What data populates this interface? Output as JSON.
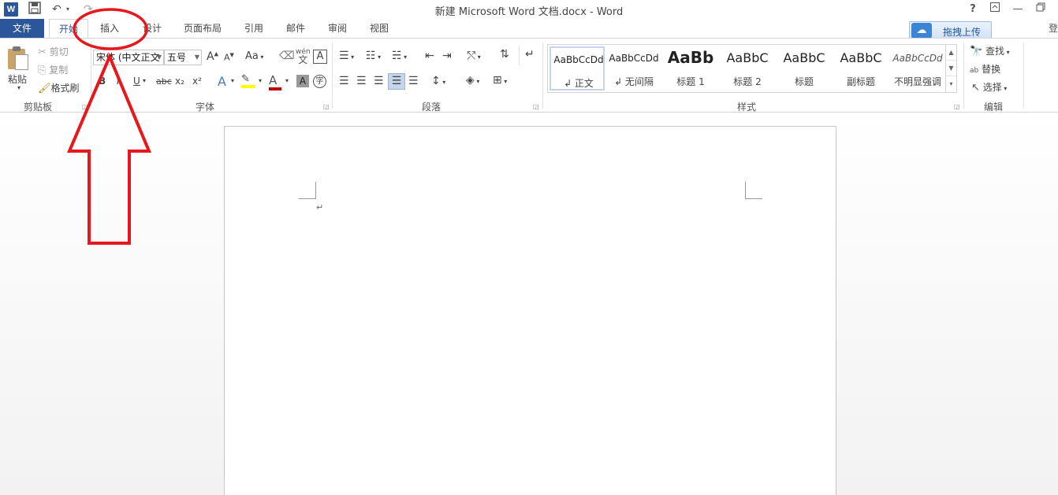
{
  "window": {
    "title": "新建 Microsoft Word 文档.docx - Word",
    "app_icon": "W",
    "help_label": "?",
    "right_edge_glyph": "登"
  },
  "quick_access": {
    "save_icon": "save-icon",
    "undo_icon": "undo-icon",
    "redo_icon": "redo-icon"
  },
  "tabs": [
    {
      "label": "文件"
    },
    {
      "label": "开始"
    },
    {
      "label": "插入"
    },
    {
      "label": "设计"
    },
    {
      "label": "页面布局"
    },
    {
      "label": "引用"
    },
    {
      "label": "邮件"
    },
    {
      "label": "审阅"
    },
    {
      "label": "视图"
    }
  ],
  "upload_button": {
    "label": "拖拽上传"
  },
  "clipboard": {
    "paste": "粘贴",
    "cut": "剪切",
    "copy": "复制",
    "format_painter": "格式刷",
    "group_label": "剪贴板"
  },
  "font": {
    "font_name": "宋体 (中文正文",
    "font_size": "五号",
    "group_label": "字体",
    "bold": "B",
    "italic": "I",
    "underline": "U",
    "strike": "abc",
    "sub": "x₂",
    "sup": "x²",
    "grow": "A",
    "shrink": "A",
    "case": "Aa",
    "pinyin": "wén",
    "border_char": "A",
    "shade_char": "A",
    "enclose": "字"
  },
  "paragraph": {
    "group_label": "段落"
  },
  "styles": {
    "group_label": "样式",
    "items": [
      {
        "sample": "AaBbCcDd",
        "name": "↲ 正文"
      },
      {
        "sample": "AaBbCcDd",
        "name": "↲ 无间隔"
      },
      {
        "sample": "AaBb",
        "name": "标题 1"
      },
      {
        "sample": "AaBbC",
        "name": "标题 2"
      },
      {
        "sample": "AaBbC",
        "name": "标题"
      },
      {
        "sample": "AaBbC",
        "name": "副标题"
      },
      {
        "sample": "AaBbCcDd",
        "name": "不明显强调"
      }
    ]
  },
  "editing": {
    "find": "查找",
    "replace": "替换",
    "select": "选择",
    "group_label": "编辑"
  },
  "document": {
    "paragraph_mark": "↵"
  },
  "annotation": {
    "color": "#e8171b"
  }
}
